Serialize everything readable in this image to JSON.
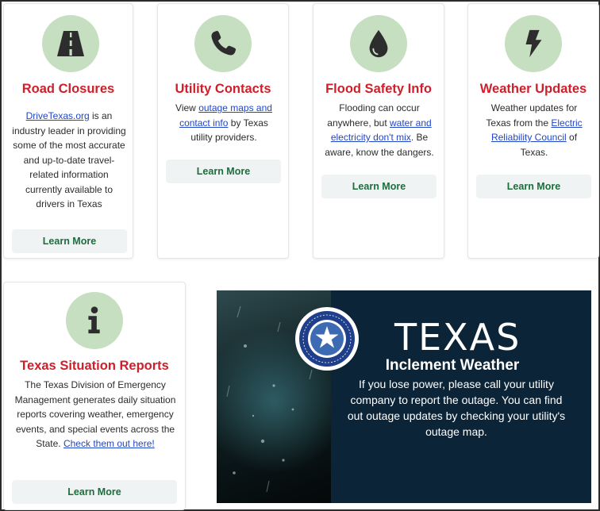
{
  "cards": [
    {
      "title": "Road Closures",
      "icon": "road-icon",
      "text_parts": [
        {
          "t": "DriveTexas.org",
          "link": true
        },
        {
          "t": " is an industry leader in providing some of the most accurate and up-to-date travel-related information currently available to drivers in Texas",
          "link": false
        }
      ],
      "button": "Learn More"
    },
    {
      "title": "Utility Contacts",
      "icon": "phone-icon",
      "text_parts": [
        {
          "t": "View ",
          "link": false
        },
        {
          "t": "outage maps and contact info",
          "link": true
        },
        {
          "t": " by Texas utility providers.",
          "link": false
        }
      ],
      "button": "Learn More"
    },
    {
      "title": "Flood Safety Info",
      "icon": "water-drop-icon",
      "text_parts": [
        {
          "t": "Flooding can occur anywhere, but ",
          "link": false
        },
        {
          "t": "water and electricity don't mix",
          "link": true
        },
        {
          "t": ". Be aware, know the dangers.",
          "link": false
        }
      ],
      "button": "Learn More"
    },
    {
      "title": "Weather Updates",
      "icon": "lightning-bolt-icon",
      "text_parts": [
        {
          "t": "Weather updates for Texas from the ",
          "link": false
        },
        {
          "t": "Electric Reliability Council",
          "link": true
        },
        {
          "t": " of Texas.",
          "link": false
        }
      ],
      "button": "Learn More"
    },
    {
      "title": "Texas Situation Reports",
      "icon": "info-icon",
      "text_parts": [
        {
          "t": "The Texas Division of Emergency Management generates daily situation reports covering weather, emergency events, and special events across the State. ",
          "link": false
        },
        {
          "t": "Check them out here!",
          "link": true
        }
      ],
      "button": "Learn More"
    }
  ],
  "banner": {
    "title": "TEXAS",
    "subtitle": "Inclement Weather",
    "body": "If you lose power, please call your utility company to report the outage. You can find out outage updates by checking your utility's outage map.",
    "seal_icon": "puc-texas-seal-icon"
  },
  "colors": {
    "title_red": "#cf1f2a",
    "icon_circle": "#c6dfc0",
    "button_text": "#1d6e3c",
    "link_blue": "#2146c7",
    "banner_navy": "#0c2438"
  }
}
